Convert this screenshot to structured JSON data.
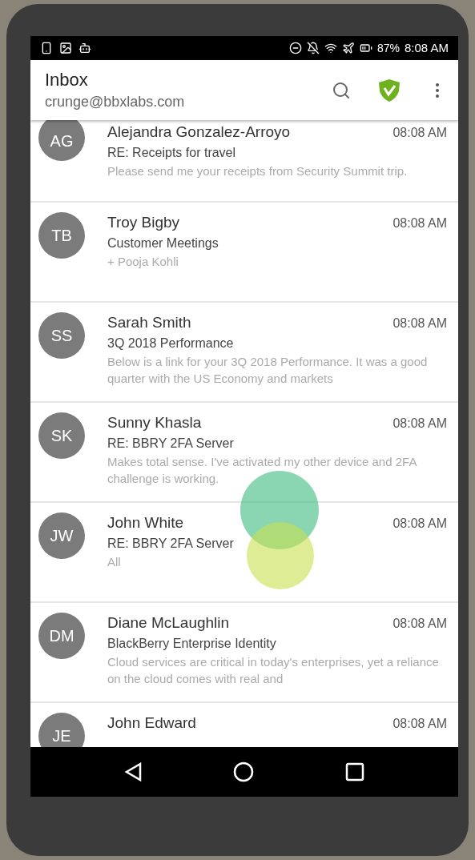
{
  "status_bar": {
    "battery": "87%",
    "time": "8:08 AM"
  },
  "header": {
    "title": "Inbox",
    "account": "crunge@bbxlabs.com"
  },
  "messages": [
    {
      "initials": "AG",
      "sender": "Alejandra Gonzalez-Arroyo",
      "time": "08:08 AM",
      "subject": "RE: Receipts for travel",
      "preview": "Please send me your receipts from Security Summit trip."
    },
    {
      "initials": "TB",
      "sender": "Troy Bigby",
      "time": "08:08 AM",
      "subject": "Customer Meetings",
      "preview": "+ Pooja Kohli"
    },
    {
      "initials": "SS",
      "sender": "Sarah Smith",
      "time": "08:08 AM",
      "subject": "3Q 2018 Performance",
      "preview": "Below is a link for your 3Q 2018 Performance. It was a good quarter with the US Economy and markets"
    },
    {
      "initials": "SK",
      "sender": "Sunny Khasla",
      "time": "08:08 AM",
      "subject": "RE: BBRY 2FA Server",
      "preview": "Makes total sense. I've activated my other device and 2FA challenge is working."
    },
    {
      "initials": "JW",
      "sender": "John White",
      "time": "08:08 AM",
      "subject": "RE: BBRY 2FA Server",
      "preview": "All"
    },
    {
      "initials": "DM",
      "sender": "Diane McLaughlin",
      "time": "08:08 AM",
      "subject": "BlackBerry Enterprise Identity",
      "preview": "Cloud services are critical in today's enterprises, yet a reliance on the cloud comes with real and"
    },
    {
      "initials": "JE",
      "sender": "John Edward",
      "time": "08:08 AM"
    }
  ]
}
